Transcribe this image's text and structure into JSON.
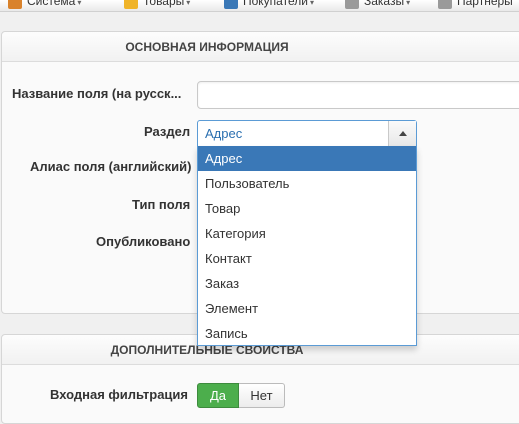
{
  "topbar": {
    "items": [
      {
        "label": "Система",
        "icon": "wrench-icon",
        "color": "#d9822b"
      },
      {
        "label": "Товары",
        "icon": "box-icon",
        "color": "#f0b429"
      },
      {
        "label": "Покупатели",
        "icon": "users-icon",
        "color": "#3a78b7"
      },
      {
        "label": "Заказы",
        "icon": "orders-icon",
        "color": "#8a8a8a"
      },
      {
        "label": "Партнеры",
        "icon": "partners-icon",
        "color": "#8a8a8a"
      }
    ]
  },
  "main_panel": {
    "title": "ОСНОВНАЯ ИНФОРМАЦИЯ",
    "field_name_label": "Название поля (на русск...",
    "field_name_value": "",
    "section_label": "Раздел",
    "section_value": "Адрес",
    "alias_label": "Алиас поля (английский)",
    "type_label": "Тип поля",
    "published_label": "Опубликовано"
  },
  "section_dropdown": {
    "options": [
      "Адрес",
      "Пользователь",
      "Товар",
      "Категория",
      "Контакт",
      "Заказ",
      "Элемент",
      "Запись"
    ],
    "selected_index": 0
  },
  "extra_panel": {
    "title": "ДОПОЛНИТЕЛЬНЫЕ СВОЙСТВА",
    "input_filter_label": "Входная фильтрация",
    "yes_label": "Да",
    "no_label": "Нет",
    "selected": "Да"
  },
  "colors": {
    "accent": "#3a78b7",
    "toggle_on": "#4cae4c"
  }
}
